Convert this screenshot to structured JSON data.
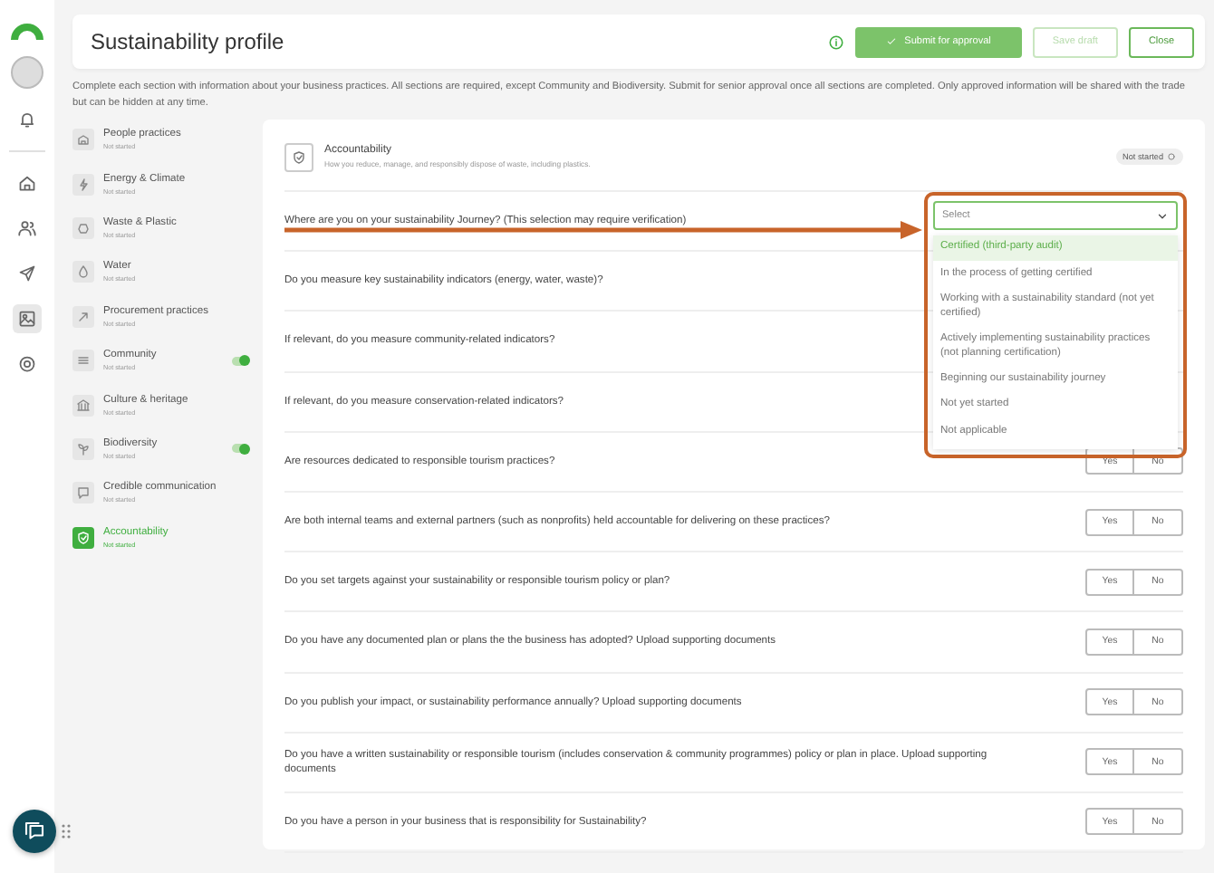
{
  "header": {
    "title": "Sustainability profile",
    "buttons": [
      {
        "label": "Submit for approval",
        "kind": "primary"
      },
      {
        "label": "Save draft",
        "kind": "disabled"
      },
      {
        "label": "Close",
        "kind": "outline"
      }
    ]
  },
  "description": "Complete each section with information about your business practices. All sections are required, except Community and Biodiversity. Submit for senior approval once all sections are completed. Only approved information will be shared with the trade but can be hidden at any time.",
  "sections": [
    {
      "name": "People practices",
      "status": "Not started",
      "kind": "plain",
      "selected": false
    },
    {
      "name": "Energy & Climate",
      "status": "Not started",
      "kind": "plain",
      "selected": false
    },
    {
      "name": "Waste & Plastic",
      "status": "Not started",
      "kind": "plain",
      "selected": false
    },
    {
      "name": "Water",
      "status": "Not started",
      "kind": "plain",
      "selected": false
    },
    {
      "name": "Procurement practices",
      "status": "Not started",
      "kind": "plain",
      "selected": false
    },
    {
      "name": "Community",
      "status": "Not started",
      "kind": "toggle",
      "on": true,
      "selected": false
    },
    {
      "name": "Culture & heritage",
      "status": "Not started",
      "kind": "plain",
      "selected": false
    },
    {
      "name": "Biodiversity",
      "status": "Not started",
      "kind": "toggle",
      "on": true,
      "selected": false
    },
    {
      "name": "Credible communication",
      "status": "Not started",
      "kind": "plain",
      "selected": false
    },
    {
      "name": "Accountability",
      "status": "Not started",
      "kind": "plain",
      "selected": true
    }
  ],
  "panel": {
    "title": "Accountability",
    "subtitle": "How you reduce, manage, and responsibly dispose of waste, including plastics.",
    "badge": "Not started"
  },
  "questions": [
    {
      "text": "Where are you on your sustainability Journey? (This selection may require verification)",
      "kind": "select"
    },
    {
      "text": "Do you measure key sustainability indicators (energy, water, waste)?",
      "kind": "covered"
    },
    {
      "text": "If relevant, do you measure community-related indicators?",
      "kind": "covered"
    },
    {
      "text": "If relevant, do you measure conservation-related indicators?",
      "kind": "covered"
    },
    {
      "text": "Are resources dedicated to responsible tourism practices?",
      "kind": "yesno",
      "yes": "Yes",
      "no": "No"
    },
    {
      "text": "Are both internal teams and external partners (such as nonprofits) held accountable for delivering on these practices?",
      "kind": "yesno",
      "yes": "Yes",
      "no": "No"
    },
    {
      "text": "Do you set targets against your sustainability or responsible tourism policy or plan?",
      "kind": "yesno",
      "yes": "Yes",
      "no": "No"
    },
    {
      "text": "Do you have any documented plan or plans the the business has adopted? Upload supporting documents",
      "kind": "yesno",
      "yes": "Yes",
      "no": "No"
    },
    {
      "text": "Do you publish your impact, or sustainability performance annually? Upload supporting documents",
      "kind": "yesno",
      "yes": "Yes",
      "no": "No"
    },
    {
      "text": "Do you have a written sustainability or responsible tourism (includes conservation & community programmes) policy or plan in place. Upload supporting documents",
      "kind": "yesno",
      "yes": "Yes",
      "no": "No"
    },
    {
      "text": "Do you have a person in your business that is responsibility for Sustainability?",
      "kind": "yesno",
      "yes": "Yes",
      "no": "No"
    }
  ],
  "dropdown": {
    "placeholder": "Select",
    "options": [
      {
        "label": "Certified (third-party audit)",
        "selected": true
      },
      {
        "label": "In the process of getting certified",
        "selected": false
      },
      {
        "label": "Working with a sustainability standard (not yet certified)",
        "selected": false
      },
      {
        "label": "Actively implementing sustainability practices (not planning certification)",
        "selected": false
      },
      {
        "label": "Beginning our sustainability journey",
        "selected": false
      },
      {
        "label": "Not yet started",
        "selected": false
      },
      {
        "label": "Not applicable",
        "selected": false
      }
    ]
  }
}
